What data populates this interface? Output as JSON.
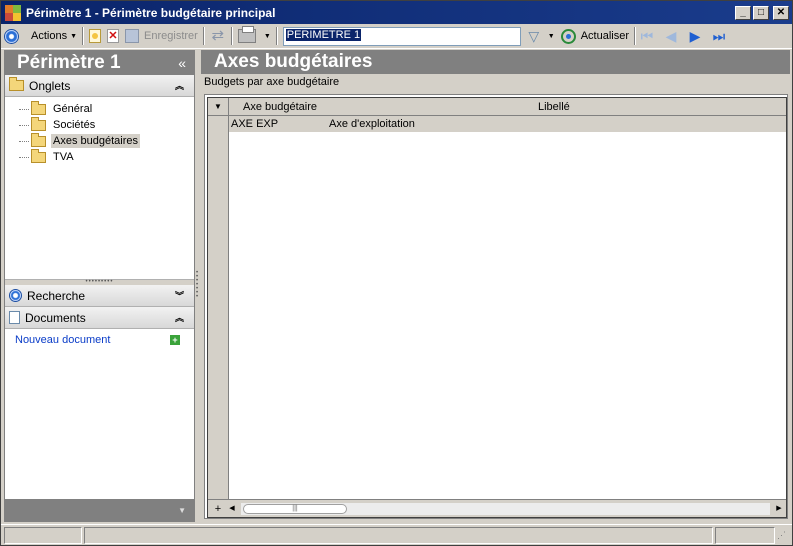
{
  "window": {
    "title": "Périmètre 1 - Périmètre budgétaire principal",
    "minimize": "_",
    "maximize": "□",
    "close": "✕"
  },
  "toolbar": {
    "actions_label": "Actions",
    "save_label": "Enregistrer",
    "record_value": "PERIMETRE 1",
    "actualiser_label": "Actualiser"
  },
  "left": {
    "title": "Périmètre 1",
    "collapse_glyph": "«",
    "onglets_label": "Onglets",
    "tree": [
      {
        "label": "Général"
      },
      {
        "label": "Sociétés"
      },
      {
        "label": "Axes budgétaires"
      },
      {
        "label": "TVA"
      }
    ],
    "recherche_label": "Recherche",
    "documents_label": "Documents",
    "nouveau_document_label": "Nouveau document"
  },
  "right": {
    "title": "Axes budgétaires",
    "group_label": "Budgets par axe budgétaire",
    "grid": {
      "columns": [
        "Axe budgétaire",
        "Libellé"
      ],
      "rows": [
        {
          "axe": "AXE EXP",
          "libelle": "Axe d'exploitation"
        }
      ]
    }
  },
  "colors": {
    "titlebar": "#0a246a",
    "pane_header": "#808080",
    "link": "#0a3cc8",
    "selected_row": "#d4d0c8"
  }
}
